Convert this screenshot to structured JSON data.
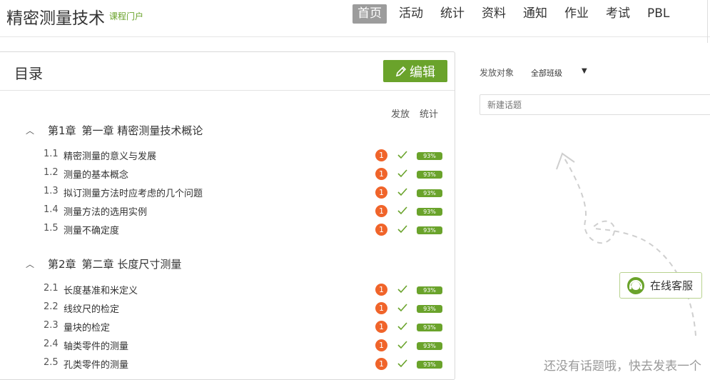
{
  "header": {
    "course_title": "精密测量技术",
    "portal_link": "课程门户",
    "nav": [
      {
        "label": "首页",
        "active": true
      },
      {
        "label": "活动",
        "active": false
      },
      {
        "label": "统计",
        "active": false
      },
      {
        "label": "资料",
        "active": false
      },
      {
        "label": "通知",
        "active": false
      },
      {
        "label": "作业",
        "active": false
      },
      {
        "label": "考试",
        "active": false
      },
      {
        "label": "PBL",
        "active": false
      }
    ]
  },
  "catalog": {
    "title": "目录",
    "edit_label": "编辑",
    "col_publish": "发放",
    "col_stats": "统计",
    "chapters": [
      {
        "index": "第1章",
        "title": "第一章 精密测量技术概论",
        "lessons": [
          {
            "num": "1.1",
            "name": "精密测量的意义与发展",
            "badge": "1",
            "pct": "93%"
          },
          {
            "num": "1.2",
            "name": "测量的基本概念",
            "badge": "1",
            "pct": "93%"
          },
          {
            "num": "1.3",
            "name": "拟订测量方法时应考虑的几个问题",
            "badge": "1",
            "pct": "93%"
          },
          {
            "num": "1.4",
            "name": "测量方法的选用实例",
            "badge": "1",
            "pct": "93%"
          },
          {
            "num": "1.5",
            "name": "测量不确定度",
            "badge": "1",
            "pct": "93%"
          }
        ]
      },
      {
        "index": "第2章",
        "title": "第二章 长度尺寸测量",
        "lessons": [
          {
            "num": "2.1",
            "name": "长度基准和米定义",
            "badge": "1",
            "pct": "93%"
          },
          {
            "num": "2.2",
            "name": "线纹尺的检定",
            "badge": "1",
            "pct": "93%"
          },
          {
            "num": "2.3",
            "name": "量块的检定",
            "badge": "1",
            "pct": "93%"
          },
          {
            "num": "2.4",
            "name": "轴类零件的测量",
            "badge": "1",
            "pct": "93%"
          },
          {
            "num": "2.5",
            "name": "孔类零件的测量",
            "badge": "1",
            "pct": "93%"
          }
        ]
      }
    ]
  },
  "discussion": {
    "target_label": "发放对象",
    "target_value": "全部班级",
    "new_topic_placeholder": "新建话题",
    "service_label": "在线客服",
    "empty_hint": "还没有话题哦，快去发表一个"
  },
  "colors": {
    "accent": "#6aa32b",
    "badge": "#f0642a",
    "nav_active": "#9c9c9c"
  }
}
